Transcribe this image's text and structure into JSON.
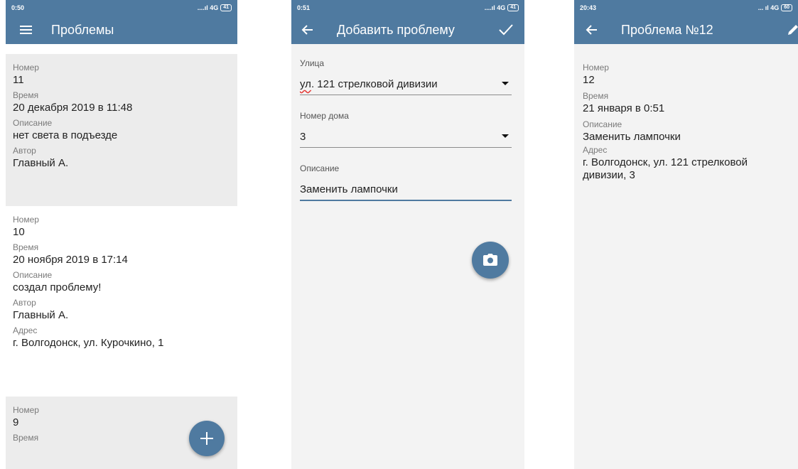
{
  "colors": {
    "primary": "#4f7aa0",
    "card_shaded": "#ececec",
    "background": "#f3f3f3"
  },
  "screen_list": {
    "status": {
      "time": "0:50",
      "network": "....ıl 4G",
      "battery": "41"
    },
    "title": "Проблемы",
    "nav_icon": "menu-icon",
    "items": [
      {
        "fields": [
          {
            "label": "Номер",
            "value": "11"
          },
          {
            "label": "Время",
            "value": "20 декабря 2019 в 11:48"
          },
          {
            "label": "Описание",
            "value": "нет света в подъезде"
          },
          {
            "label": "Автор",
            "value": "Главный А."
          }
        ]
      },
      {
        "fields": [
          {
            "label": "Номер",
            "value": "10"
          },
          {
            "label": "Время",
            "value": "20 ноября 2019 в 17:14"
          },
          {
            "label": "Описание",
            "value": "создал проблему!"
          },
          {
            "label": "Автор",
            "value": "Главный А."
          },
          {
            "label": "Адрес",
            "value": "г. Волгодонск, ул. Курочкино, 1"
          }
        ]
      },
      {
        "fields": [
          {
            "label": "Номер",
            "value": "9"
          },
          {
            "label": "Время",
            "value": ""
          }
        ]
      }
    ],
    "fab_icon": "plus-icon"
  },
  "screen_add": {
    "status": {
      "time": "0:51",
      "network": "....ıl 4G",
      "battery": "41"
    },
    "title": "Добавить проблему",
    "nav_icon": "arrow-back-icon",
    "action_icon": "check-icon",
    "street_label": "Улица",
    "street_value_prefix": "ул",
    "street_value_rest": ". 121 стрелковой дивизии",
    "house_label": "Номер дома",
    "house_value": "3",
    "description_label": "Описание",
    "description_value": "Заменить лампочки",
    "fab_icon": "camera-icon"
  },
  "screen_detail": {
    "status": {
      "time": "20:43",
      "network": "... ıl 4G",
      "battery": "60"
    },
    "title": "Проблема №12",
    "nav_icon": "arrow-back-icon",
    "action_icon": "edit-icon",
    "fields": [
      {
        "label": "Номер",
        "value": "12"
      },
      {
        "label": "Время",
        "value": "21 января в 0:51"
      },
      {
        "label": "Описание",
        "value": "Заменить лампочки"
      },
      {
        "label": "Адрес",
        "value": "г. Волгодонск, ул. 121 стрелковой дивизии, 3"
      }
    ]
  }
}
